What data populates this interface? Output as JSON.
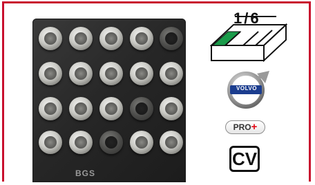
{
  "tray": {
    "rows": [
      [
        "light",
        "light",
        "light",
        "light",
        "dark"
      ],
      [
        "light",
        "light",
        "light",
        "light",
        "light"
      ],
      [
        "light",
        "light",
        "light",
        "dark",
        "light"
      ],
      [
        "light",
        "light",
        "dark",
        "light",
        "light"
      ]
    ],
    "logo_text": "BGS"
  },
  "badges": {
    "drive_size": "1/6",
    "drive_icon": "drive-segment-icon",
    "brand_logo": "volvo-logo",
    "brand_text": "VOLVO",
    "pro_label": "PRO",
    "pro_plus": "+",
    "cv_label": "CV"
  },
  "colors": {
    "frame": "#c8102e",
    "drive_highlight": "#1a9b4a",
    "volvo_blue": "#1b3d8f",
    "pro_plus": "#e30613"
  }
}
